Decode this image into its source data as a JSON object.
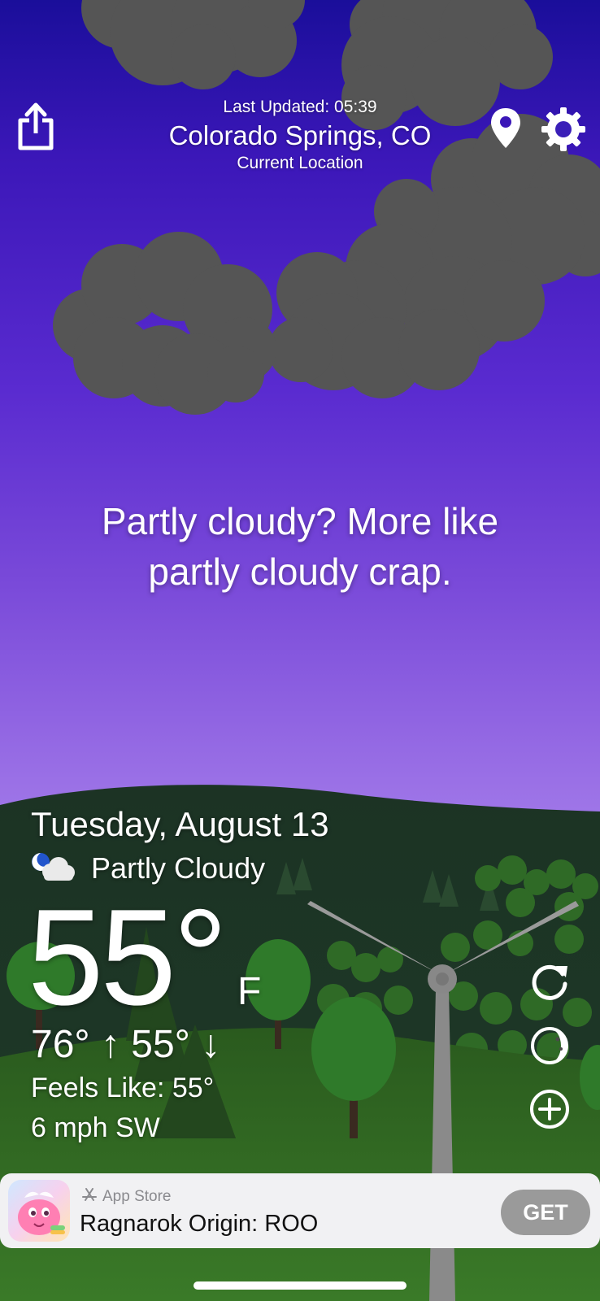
{
  "header": {
    "last_updated": "Last Updated: 05:39",
    "city": "Colorado Springs, CO",
    "location_label": "Current Location"
  },
  "quote": {
    "line1": "Partly cloudy? More like",
    "line2": "partly cloudy crap."
  },
  "weather": {
    "date": "Tuesday, August 13",
    "condition": "Partly Cloudy",
    "condition_icon": "partly-cloudy-night-icon",
    "temperature": "55°",
    "unit": "F",
    "high": "76°",
    "low": "55°",
    "feels_like": "Feels Like: 55°",
    "wind": "6 mph SW"
  },
  "icons": {
    "share": "share-icon",
    "location": "location-pin-icon",
    "settings": "gear-icon",
    "refresh": "refresh-icon",
    "moon": "moon-phase-icon",
    "add": "add-circle-icon"
  },
  "ad": {
    "store_label": "App Store",
    "title": "Ragnarok Origin: ROO",
    "button": "GET"
  },
  "colors": {
    "sky_top": "#1a0e9a",
    "sky_bottom": "#c4a5f4",
    "cloud": "#555555",
    "hill_dark": "#1f3a26",
    "hill_light": "#2e5a1e"
  }
}
